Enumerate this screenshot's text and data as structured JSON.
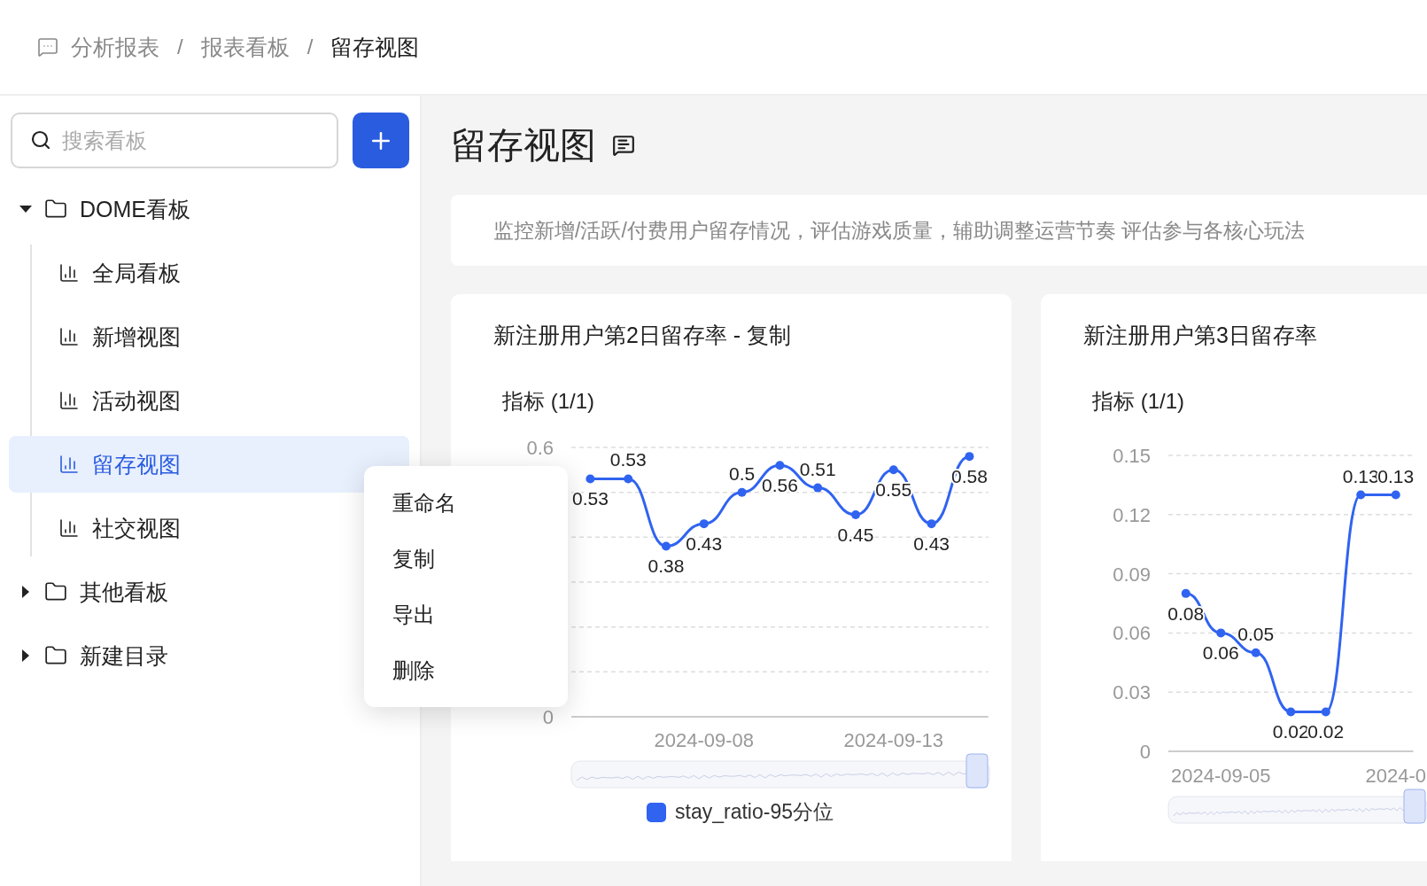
{
  "breadcrumb": [
    {
      "label": "分析报表",
      "selected": false
    },
    {
      "separator": "/",
      "label": "报表看板",
      "selected": false
    },
    {
      "separator": "/",
      "label": "留存视图",
      "selected": true
    }
  ],
  "sidebar": {
    "search": {
      "placeholder": "搜索看板"
    },
    "tree": [
      {
        "label": "DOME看板",
        "kind": "folder",
        "expanded": true,
        "selected": false,
        "children": [
          {
            "label": "全局看板",
            "kind": "board",
            "selected": false
          },
          {
            "label": "新增视图",
            "kind": "board",
            "selected": false
          },
          {
            "label": "活动视图",
            "kind": "board",
            "selected": false
          },
          {
            "label": "留存视图",
            "kind": "board",
            "selected": true
          },
          {
            "label": "社交视图",
            "kind": "board",
            "selected": false
          }
        ]
      },
      {
        "label": "其他看板",
        "kind": "folder",
        "expanded": false,
        "selected": false
      },
      {
        "label": "新建目录",
        "kind": "folder",
        "expanded": false,
        "selected": false
      }
    ]
  },
  "context_menu": {
    "items": [
      "重命名",
      "复制",
      "导出",
      "删除"
    ]
  },
  "page": {
    "title": "留存视图",
    "description": "监控新增/活跃/付费用户留存情况，评估游戏质量，辅助调整运营节奏 评估参与各核心玩法"
  },
  "cards": [
    {
      "title": "新注册用户第2日留存率 - 复制",
      "metric_label": "指标 (1/1)",
      "chart_data": {
        "type": "line",
        "categories": [
          null,
          null,
          null,
          "2024-09-08",
          null,
          null,
          null,
          null,
          "2024-09-13",
          null,
          null
        ],
        "series": [
          {
            "name": "stay_ratio-95分位",
            "color": "#3063f0",
            "marker": true,
            "values": [
              0.53,
              0.53,
              0.38,
              0.43,
              0.5,
              0.56,
              0.51,
              0.45,
              0.55,
              0.43,
              0.58
            ]
          }
        ],
        "ylim": [
          0,
          0.6
        ],
        "yticks": [
          0,
          0.6
        ],
        "grid": true,
        "data_labels": true
      }
    },
    {
      "title": "新注册用户第3日留存率",
      "metric_label": "指标 (1/1)",
      "chart_data": {
        "type": "line",
        "categories": [
          null,
          "2024-09-05",
          null,
          null,
          null,
          null,
          "2024-0"
        ],
        "series": [
          {
            "color": "#3063f0",
            "marker": true,
            "values": [
              0.08,
              0.06,
              0.05,
              0.02,
              0.02,
              0.13,
              0.13
            ]
          }
        ],
        "ylim": [
          0,
          0.15
        ],
        "yticks": [
          0,
          0.03,
          0.06,
          0.09,
          0.12,
          0.15
        ],
        "grid": true,
        "data_labels": true
      }
    }
  ]
}
